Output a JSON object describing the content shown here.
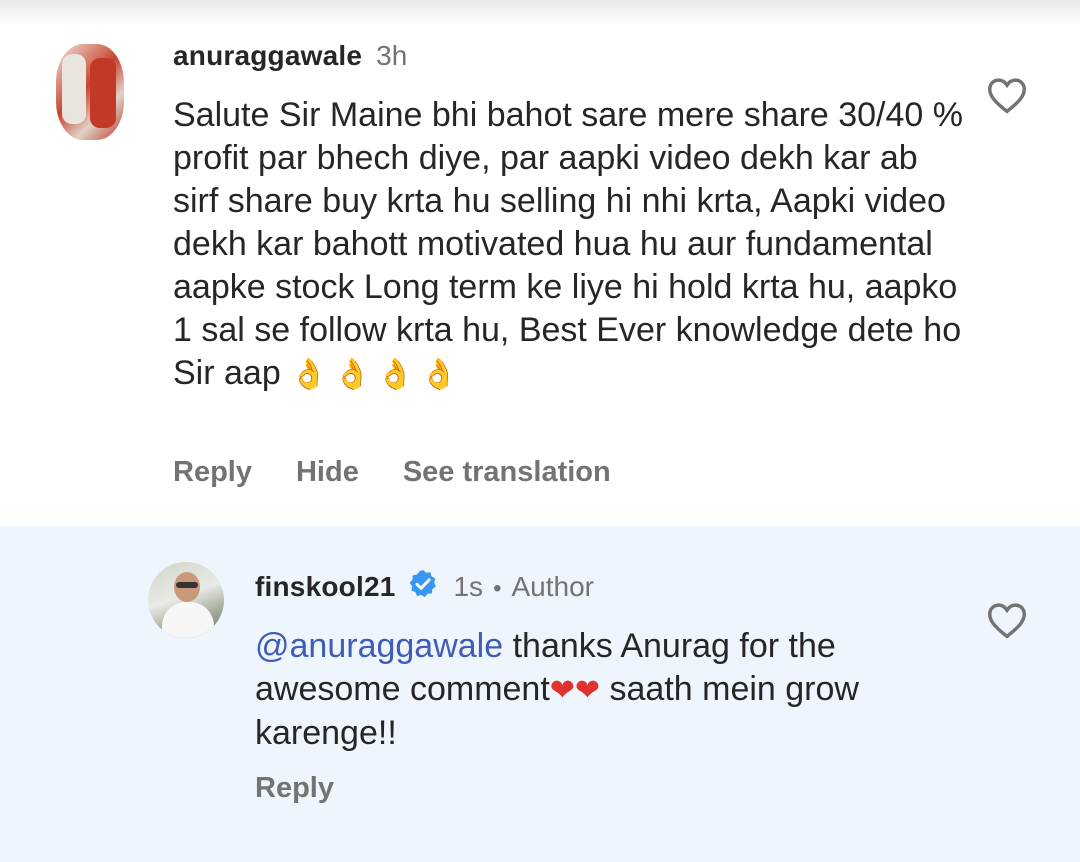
{
  "comments": [
    {
      "username": "anuraggawale",
      "time": "3h",
      "text": "Salute Sir Maine bhi bahot sare mere share 30/40 % profit par bhech diye, par aapki video dekh kar ab sirf share buy krta hu selling hi nhi krta, Aapki video dekh kar bahott motivated hua hu aur fundamental aapke stock Long term ke liye hi hold krta hu,  aapko  1 sal se follow krta hu, Best Ever knowledge dete ho Sir aap",
      "emoji": "👌👌👌👌",
      "actions": {
        "reply": "Reply",
        "hide": "Hide",
        "translate": "See translation"
      },
      "like_icon": "heart-outline-icon"
    },
    {
      "username": "finskool21",
      "verified": true,
      "time": "1s",
      "separator": "•",
      "role": "Author",
      "mention": "@anuraggawale",
      "text_part1": " thanks Anurag for the awesome comment",
      "emoji": "❤❤",
      "text_part2": " saath mein grow karenge!!",
      "actions": {
        "reply": "Reply"
      },
      "like_icon": "heart-outline-icon"
    }
  ],
  "colors": {
    "verified_badge": "#3897f0",
    "mention": "#3f5db6",
    "reply_highlight_bg": "#eef5fd"
  }
}
